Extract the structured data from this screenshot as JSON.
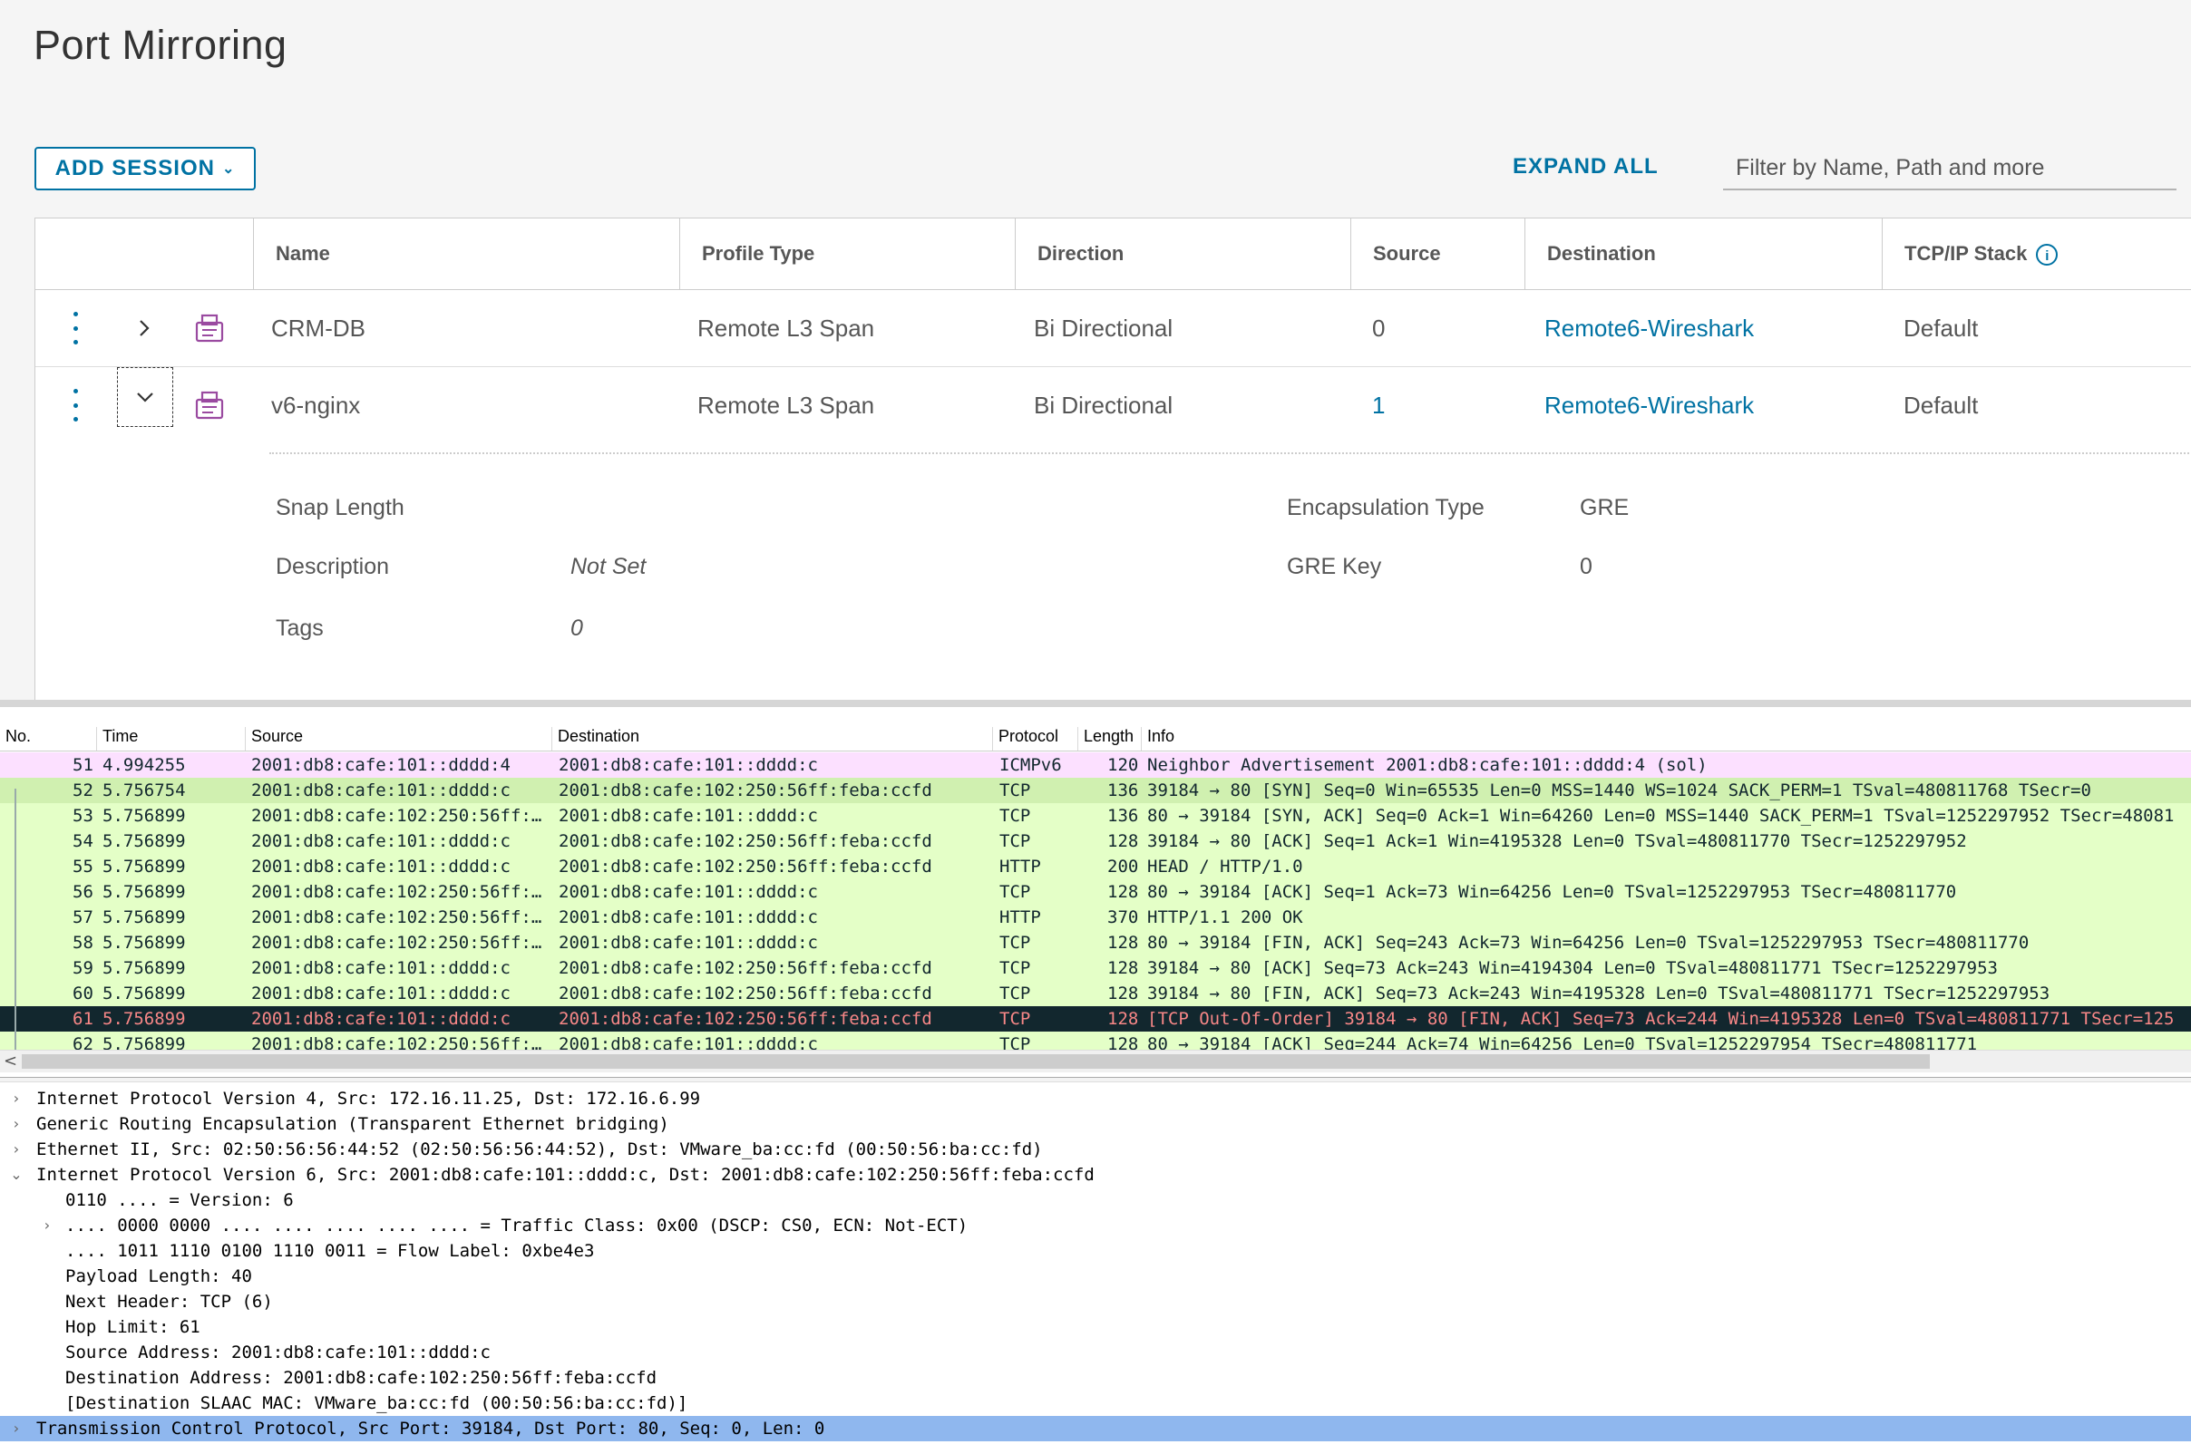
{
  "title": "Port Mirroring",
  "toolbar": {
    "add_session": "ADD SESSION",
    "expand_all": "EXPAND ALL",
    "filter_placeholder": "Filter by Name, Path and more"
  },
  "columns": {
    "name": "Name",
    "profile_type": "Profile Type",
    "direction": "Direction",
    "source": "Source",
    "destination": "Destination",
    "stack": "TCP/IP Stack"
  },
  "sessions": [
    {
      "name": "CRM-DB",
      "profile_type": "Remote L3 Span",
      "direction": "Bi Directional",
      "source": "0",
      "destination": "Remote6-Wireshark",
      "stack": "Default"
    },
    {
      "name": "v6-nginx",
      "profile_type": "Remote L3 Span",
      "direction": "Bi Directional",
      "source": "1",
      "destination": "Remote6-Wireshark",
      "stack": "Default"
    }
  ],
  "details": {
    "snap_length_label": "Snap Length",
    "description_label": "Description",
    "description_value": "Not Set",
    "tags_label": "Tags",
    "tags_value": "0",
    "encap_label": "Encapsulation Type",
    "encap_value": "GRE",
    "gre_key_label": "GRE Key",
    "gre_key_value": "0"
  },
  "packet_columns": {
    "no": "No.",
    "time": "Time",
    "source": "Source",
    "destination": "Destination",
    "protocol": "Protocol",
    "length": "Length",
    "info": "Info"
  },
  "packets": [
    {
      "no": "51",
      "time": "4.994255",
      "src": "2001:db8:cafe:101::dddd:4",
      "dst": "2001:db8:cafe:101::dddd:c",
      "proto": "ICMPv6",
      "len": "120",
      "info": "Neighbor Advertisement 2001:db8:cafe:101::dddd:4 (sol)"
    },
    {
      "no": "52",
      "time": "5.756754",
      "src": "2001:db8:cafe:101::dddd:c",
      "dst": "2001:db8:cafe:102:250:56ff:feba:ccfd",
      "proto": "TCP",
      "len": "136",
      "info": "39184 → 80 [SYN] Seq=0 Win=65535 Len=0 MSS=1440 WS=1024 SACK_PERM=1 TSval=480811768 TSecr=0"
    },
    {
      "no": "53",
      "time": "5.756899",
      "src": "2001:db8:cafe:102:250:56ff:…",
      "dst": "2001:db8:cafe:101::dddd:c",
      "proto": "TCP",
      "len": "136",
      "info": "80 → 39184 [SYN, ACK] Seq=0 Ack=1 Win=64260 Len=0 MSS=1440 SACK_PERM=1 TSval=1252297952 TSecr=48081"
    },
    {
      "no": "54",
      "time": "5.756899",
      "src": "2001:db8:cafe:101::dddd:c",
      "dst": "2001:db8:cafe:102:250:56ff:feba:ccfd",
      "proto": "TCP",
      "len": "128",
      "info": "39184 → 80 [ACK] Seq=1 Ack=1 Win=4195328 Len=0 TSval=480811770 TSecr=1252297952"
    },
    {
      "no": "55",
      "time": "5.756899",
      "src": "2001:db8:cafe:101::dddd:c",
      "dst": "2001:db8:cafe:102:250:56ff:feba:ccfd",
      "proto": "HTTP",
      "len": "200",
      "info": "HEAD / HTTP/1.0"
    },
    {
      "no": "56",
      "time": "5.756899",
      "src": "2001:db8:cafe:102:250:56ff:…",
      "dst": "2001:db8:cafe:101::dddd:c",
      "proto": "TCP",
      "len": "128",
      "info": "80 → 39184 [ACK] Seq=1 Ack=73 Win=64256 Len=0 TSval=1252297953 TSecr=480811770"
    },
    {
      "no": "57",
      "time": "5.756899",
      "src": "2001:db8:cafe:102:250:56ff:…",
      "dst": "2001:db8:cafe:101::dddd:c",
      "proto": "HTTP",
      "len": "370",
      "info": "HTTP/1.1 200 OK"
    },
    {
      "no": "58",
      "time": "5.756899",
      "src": "2001:db8:cafe:102:250:56ff:…",
      "dst": "2001:db8:cafe:101::dddd:c",
      "proto": "TCP",
      "len": "128",
      "info": "80 → 39184 [FIN, ACK] Seq=243 Ack=73 Win=64256 Len=0 TSval=1252297953 TSecr=480811770"
    },
    {
      "no": "59",
      "time": "5.756899",
      "src": "2001:db8:cafe:101::dddd:c",
      "dst": "2001:db8:cafe:102:250:56ff:feba:ccfd",
      "proto": "TCP",
      "len": "128",
      "info": "39184 → 80 [ACK] Seq=73 Ack=243 Win=4194304 Len=0 TSval=480811771 TSecr=1252297953"
    },
    {
      "no": "60",
      "time": "5.756899",
      "src": "2001:db8:cafe:101::dddd:c",
      "dst": "2001:db8:cafe:102:250:56ff:feba:ccfd",
      "proto": "TCP",
      "len": "128",
      "info": "39184 → 80 [FIN, ACK] Seq=73 Ack=243 Win=4195328 Len=0 TSval=480811771 TSecr=1252297953"
    },
    {
      "no": "61",
      "time": "5.756899",
      "src": "2001:db8:cafe:101::dddd:c",
      "dst": "2001:db8:cafe:102:250:56ff:feba:ccfd",
      "proto": "TCP",
      "len": "128",
      "info": "[TCP Out-Of-Order] 39184 → 80 [FIN, ACK] Seq=73 Ack=244 Win=4195328 Len=0 TSval=480811771 TSecr=125"
    },
    {
      "no": "62",
      "time": "5.756899",
      "src": "2001:db8:cafe:102:250:56ff:…",
      "dst": "2001:db8:cafe:101::dddd:c",
      "proto": "TCP",
      "len": "128",
      "info": "80 → 39184 [ACK] Seq=244 Ack=74 Win=64256 Len=0 TSval=1252297954 TSecr=480811771"
    }
  ],
  "detail_lines": [
    "Internet Protocol Version 4, Src: 172.16.11.25, Dst: 172.16.6.99",
    "Generic Routing Encapsulation (Transparent Ethernet bridging)",
    "Ethernet II, Src: 02:50:56:56:44:52 (02:50:56:56:44:52), Dst: VMware_ba:cc:fd (00:50:56:ba:cc:fd)",
    "Internet Protocol Version 6, Src: 2001:db8:cafe:101::dddd:c, Dst: 2001:db8:cafe:102:250:56ff:feba:ccfd",
    "0110 .... = Version: 6",
    ".... 0000 0000 .... .... .... .... .... = Traffic Class: 0x00 (DSCP: CS0, ECN: Not-ECT)",
    ".... 1011 1110 0100 1110 0011 = Flow Label: 0xbe4e3",
    "Payload Length: 40",
    "Next Header: TCP (6)",
    "Hop Limit: 61",
    "Source Address: 2001:db8:cafe:101::dddd:c",
    "Destination Address: 2001:db8:cafe:102:250:56ff:feba:ccfd",
    "[Destination SLAAC MAC: VMware_ba:cc:fd (00:50:56:ba:cc:fd)]",
    "Transmission Control Protocol, Src Port: 39184, Dst Port: 80, Seq: 0, Len: 0"
  ]
}
